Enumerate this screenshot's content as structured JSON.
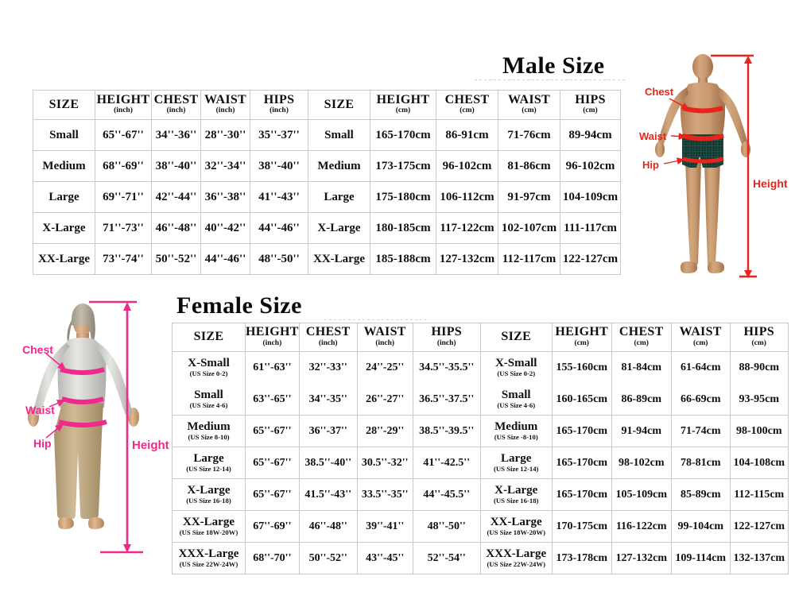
{
  "male": {
    "title": "Male Size",
    "columns_inch": [
      {
        "name": "SIZE",
        "unit": ""
      },
      {
        "name": "HEIGHT",
        "unit": "(inch)"
      },
      {
        "name": "CHEST",
        "unit": "(inch)"
      },
      {
        "name": "WAIST",
        "unit": "(inch)"
      },
      {
        "name": "HIPS",
        "unit": "(inch)"
      }
    ],
    "columns_cm": [
      {
        "name": "SIZE",
        "unit": ""
      },
      {
        "name": "HEIGHT",
        "unit": "(cm)"
      },
      {
        "name": "CHEST",
        "unit": "(cm)"
      },
      {
        "name": "WAIST",
        "unit": "(cm)"
      },
      {
        "name": "HIPS",
        "unit": "(cm)"
      }
    ],
    "rows": [
      {
        "size": "Small",
        "height_in": "65''-67''",
        "chest_in": "34''-36''",
        "waist_in": "28''-30''",
        "hips_in": "35''-37''",
        "height_cm": "165-170cm",
        "chest_cm": "86-91cm",
        "waist_cm": "71-76cm",
        "hips_cm": "89-94cm"
      },
      {
        "size": "Medium",
        "height_in": "68''-69''",
        "chest_in": "38''-40''",
        "waist_in": "32''-34''",
        "hips_in": "38''-40''",
        "height_cm": "173-175cm",
        "chest_cm": "96-102cm",
        "waist_cm": "81-86cm",
        "hips_cm": "96-102cm"
      },
      {
        "size": "Large",
        "height_in": "69''-71''",
        "chest_in": "42''-44''",
        "waist_in": "36''-38''",
        "hips_in": "41''-43''",
        "height_cm": "175-180cm",
        "chest_cm": "106-112cm",
        "waist_cm": "91-97cm",
        "hips_cm": "104-109cm"
      },
      {
        "size": "X-Large",
        "height_in": "71''-73''",
        "chest_in": "46''-48''",
        "waist_in": "40''-42''",
        "hips_in": "44''-46''",
        "height_cm": "180-185cm",
        "chest_cm": "117-122cm",
        "waist_cm": "102-107cm",
        "hips_cm": "111-117cm"
      },
      {
        "size": "XX-Large",
        "height_in": "73''-74''",
        "chest_in": "50''-52''",
        "waist_in": "44''-46''",
        "hips_in": "48''-50''",
        "height_cm": "185-188cm",
        "chest_cm": "127-132cm",
        "waist_cm": "112-117cm",
        "hips_cm": "122-127cm"
      }
    ],
    "figure": {
      "chest_label": "Chest",
      "waist_label": "Waist",
      "hip_label": "Hip",
      "height_label": "Height",
      "accent_color": "#e8241c",
      "shorts_color": "#163a33"
    }
  },
  "female": {
    "title": "Female Size",
    "columns_inch": [
      {
        "name": "SIZE",
        "unit": ""
      },
      {
        "name": "HEIGHT",
        "unit": "(inch)"
      },
      {
        "name": "CHEST",
        "unit": "(inch)"
      },
      {
        "name": "WAIST",
        "unit": "(inch)"
      },
      {
        "name": "HIPS",
        "unit": "(inch)"
      }
    ],
    "columns_cm": [
      {
        "name": "SIZE",
        "unit": ""
      },
      {
        "name": "HEIGHT",
        "unit": "(cm)"
      },
      {
        "name": "CHEST",
        "unit": "(cm)"
      },
      {
        "name": "WAIST",
        "unit": "(cm)"
      },
      {
        "name": "HIPS",
        "unit": "(cm)"
      }
    ],
    "rows": [
      {
        "size": "X-Small",
        "us_inch": "(US Size 0-2)",
        "us_cm": "(US Size 0-2)",
        "height_in": "61''-63''",
        "chest_in": "32''-33''",
        "waist_in": "24''-25''",
        "hips_in": "34.5''-35.5''",
        "height_cm": "155-160cm",
        "chest_cm": "81-84cm",
        "waist_cm": "61-64cm",
        "hips_cm": "88-90cm"
      },
      {
        "size": "Small",
        "us_inch": "(US Size 4-6)",
        "us_cm": "(US Size 4-6)",
        "height_in": "63''-65''",
        "chest_in": "34''-35''",
        "waist_in": "26''-27''",
        "hips_in": "36.5''-37.5''",
        "height_cm": "160-165cm",
        "chest_cm": "86-89cm",
        "waist_cm": "66-69cm",
        "hips_cm": "93-95cm"
      },
      {
        "size": "Medium",
        "us_inch": "(US Size 8-10)",
        "us_cm": "(US Size -8-10)",
        "height_in": "65''-67''",
        "chest_in": "36''-37''",
        "waist_in": "28''-29''",
        "hips_in": "38.5''-39.5''",
        "height_cm": "165-170cm",
        "chest_cm": "91-94cm",
        "waist_cm": "71-74cm",
        "hips_cm": "98-100cm"
      },
      {
        "size": "Large",
        "us_inch": "(US Size 12-14)",
        "us_cm": "(US Size 12-14)",
        "height_in": "65''-67''",
        "chest_in": "38.5''-40''",
        "waist_in": "30.5''-32''",
        "hips_in": "41''-42.5''",
        "height_cm": "165-170cm",
        "chest_cm": "98-102cm",
        "waist_cm": "78-81cm",
        "hips_cm": "104-108cm"
      },
      {
        "size": "X-Large",
        "us_inch": "(US Size 16-18)",
        "us_cm": "(US Size 16-18)",
        "height_in": "65''-67''",
        "chest_in": "41.5''-43''",
        "waist_in": "33.5''-35''",
        "hips_in": "44''-45.5''",
        "height_cm": "165-170cm",
        "chest_cm": "105-109cm",
        "waist_cm": "85-89cm",
        "hips_cm": "112-115cm"
      },
      {
        "size": "XX-Large",
        "us_inch": "(US Size 18W-20W)",
        "us_cm": "(US Size 18W-20W)",
        "height_in": "67''-69''",
        "chest_in": "46''-48''",
        "waist_in": "39''-41''",
        "hips_in": "48''-50''",
        "height_cm": "170-175cm",
        "chest_cm": "116-122cm",
        "waist_cm": "99-104cm",
        "hips_cm": "122-127cm"
      },
      {
        "size": "XXX-Large",
        "us_inch": "(US Size 22W-24W)",
        "us_cm": "(US Size 22W-24W)",
        "height_in": "68''-70''",
        "chest_in": "50''-52''",
        "waist_in": "43''-45''",
        "hips_in": "52''-54''",
        "height_cm": "173-178cm",
        "chest_cm": "127-132cm",
        "waist_cm": "109-114cm",
        "hips_cm": "132-137cm"
      }
    ],
    "figure": {
      "chest_label": "Chest",
      "waist_label": "Waist",
      "hip_label": "Hip",
      "height_label": "Height",
      "accent_color": "#ee2a8b",
      "top_color": "#d9d9d6",
      "pants_color": "#c9b592"
    }
  }
}
